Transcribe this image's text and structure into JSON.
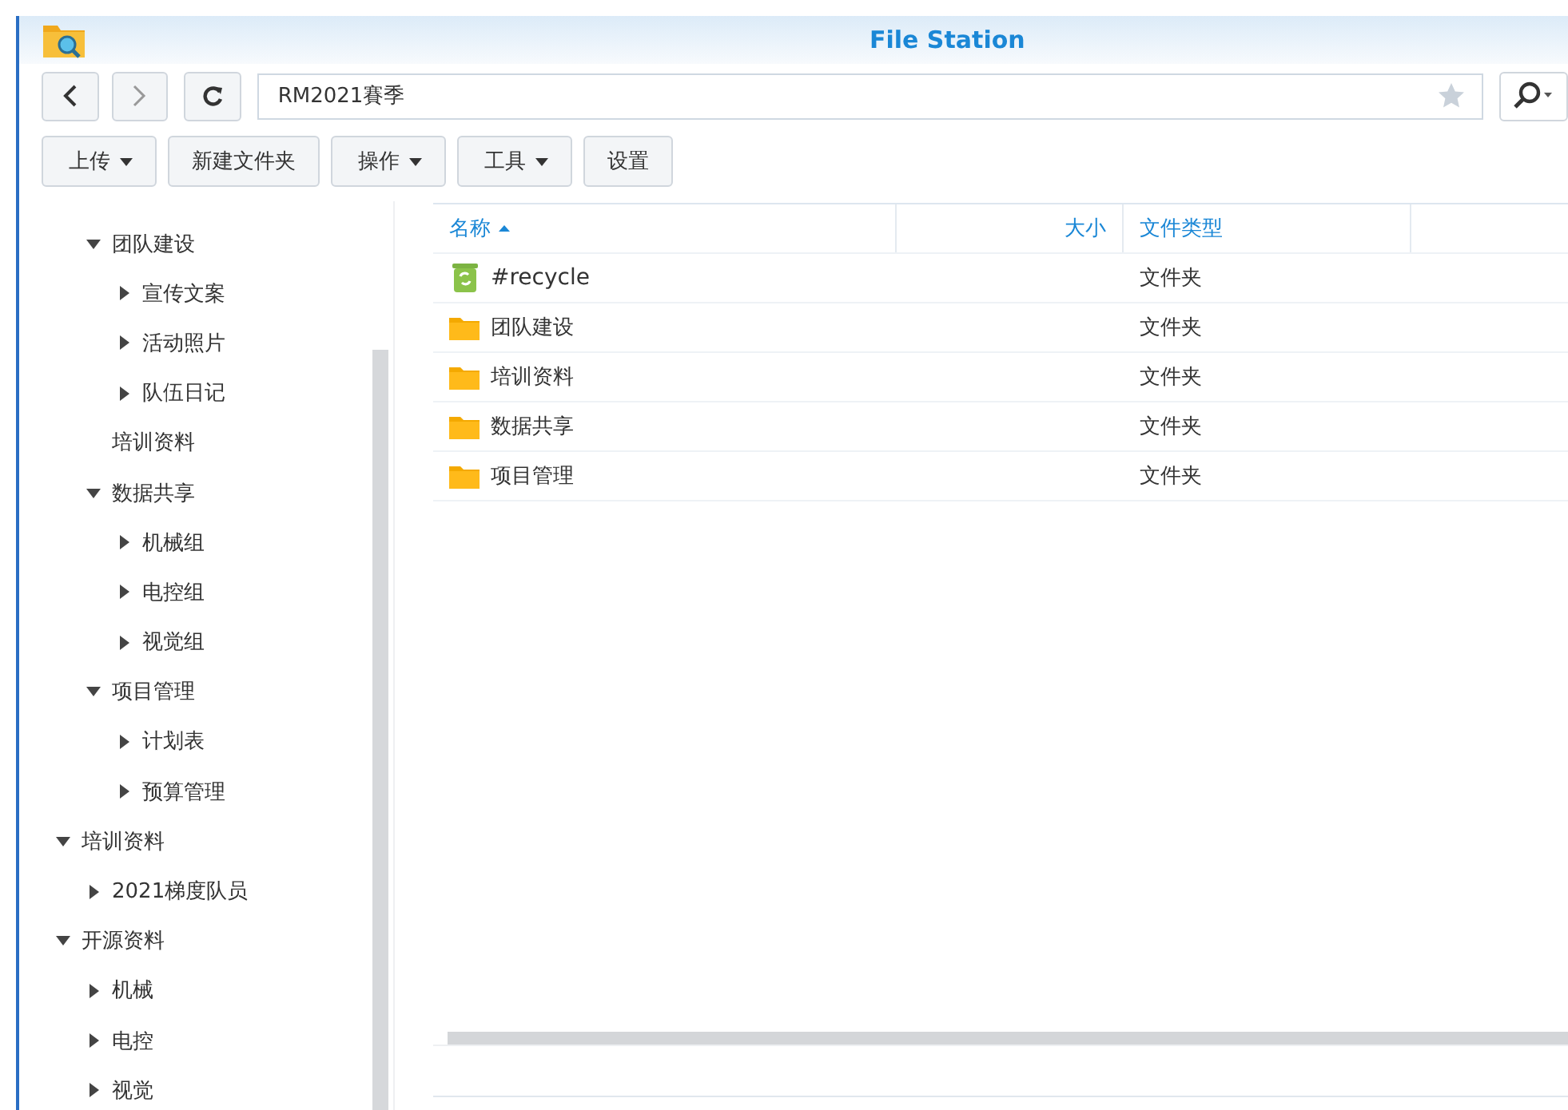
{
  "window": {
    "title": "File Station"
  },
  "nav": {
    "path": "RM2021賽季"
  },
  "toolbar": [
    {
      "label": "上传",
      "dropdown": true
    },
    {
      "label": "新建文件夹",
      "dropdown": false
    },
    {
      "label": "操作",
      "dropdown": true
    },
    {
      "label": "工具",
      "dropdown": true
    },
    {
      "label": "设置",
      "dropdown": false
    }
  ],
  "sidebar": {
    "tree": [
      {
        "children": [
          {
            "label": "团队建设",
            "kind": "branch",
            "expanded": true,
            "children": [
              {
                "label": "宣传文案",
                "kind": "branch",
                "expanded": false
              },
              {
                "label": "活动照片",
                "kind": "branch",
                "expanded": false
              },
              {
                "label": "队伍日记",
                "kind": "branch",
                "expanded": false
              }
            ]
          },
          {
            "label": "培训资料",
            "kind": "leaf"
          },
          {
            "label": "数据共享",
            "kind": "branch",
            "expanded": true,
            "children": [
              {
                "label": "机械组",
                "kind": "branch",
                "expanded": false
              },
              {
                "label": "电控组",
                "kind": "branch",
                "expanded": false
              },
              {
                "label": "视觉组",
                "kind": "branch",
                "expanded": false
              }
            ]
          },
          {
            "label": "项目管理",
            "kind": "branch",
            "expanded": true,
            "children": [
              {
                "label": "计划表",
                "kind": "branch",
                "expanded": false
              },
              {
                "label": "预算管理",
                "kind": "branch",
                "expanded": false
              }
            ]
          }
        ]
      },
      {
        "label": "培训资料",
        "kind": "branch",
        "expanded": true,
        "children": [
          {
            "label": "2021梯度队员",
            "kind": "branch",
            "expanded": false
          }
        ]
      },
      {
        "label": "开源资料",
        "kind": "branch",
        "expanded": true,
        "children": [
          {
            "label": "机械",
            "kind": "branch",
            "expanded": false
          },
          {
            "label": "电控",
            "kind": "branch",
            "expanded": false
          },
          {
            "label": "视觉",
            "kind": "branch",
            "expanded": false
          }
        ]
      }
    ]
  },
  "table": {
    "columns": [
      {
        "label": "名称",
        "sorted": true
      },
      {
        "label": "大小",
        "sorted": false
      },
      {
        "label": "文件类型",
        "sorted": false
      }
    ],
    "rows": [
      {
        "kind": "recycle",
        "name": "#recycle",
        "type": "文件夹"
      },
      {
        "kind": "folder",
        "name": "团队建设",
        "type": "文件夹"
      },
      {
        "kind": "folder",
        "name": "培训资料",
        "type": "文件夹"
      },
      {
        "kind": "folder",
        "name": "数据共享",
        "type": "文件夹"
      },
      {
        "kind": "folder",
        "name": "项目管理",
        "type": "文件夹"
      }
    ]
  }
}
